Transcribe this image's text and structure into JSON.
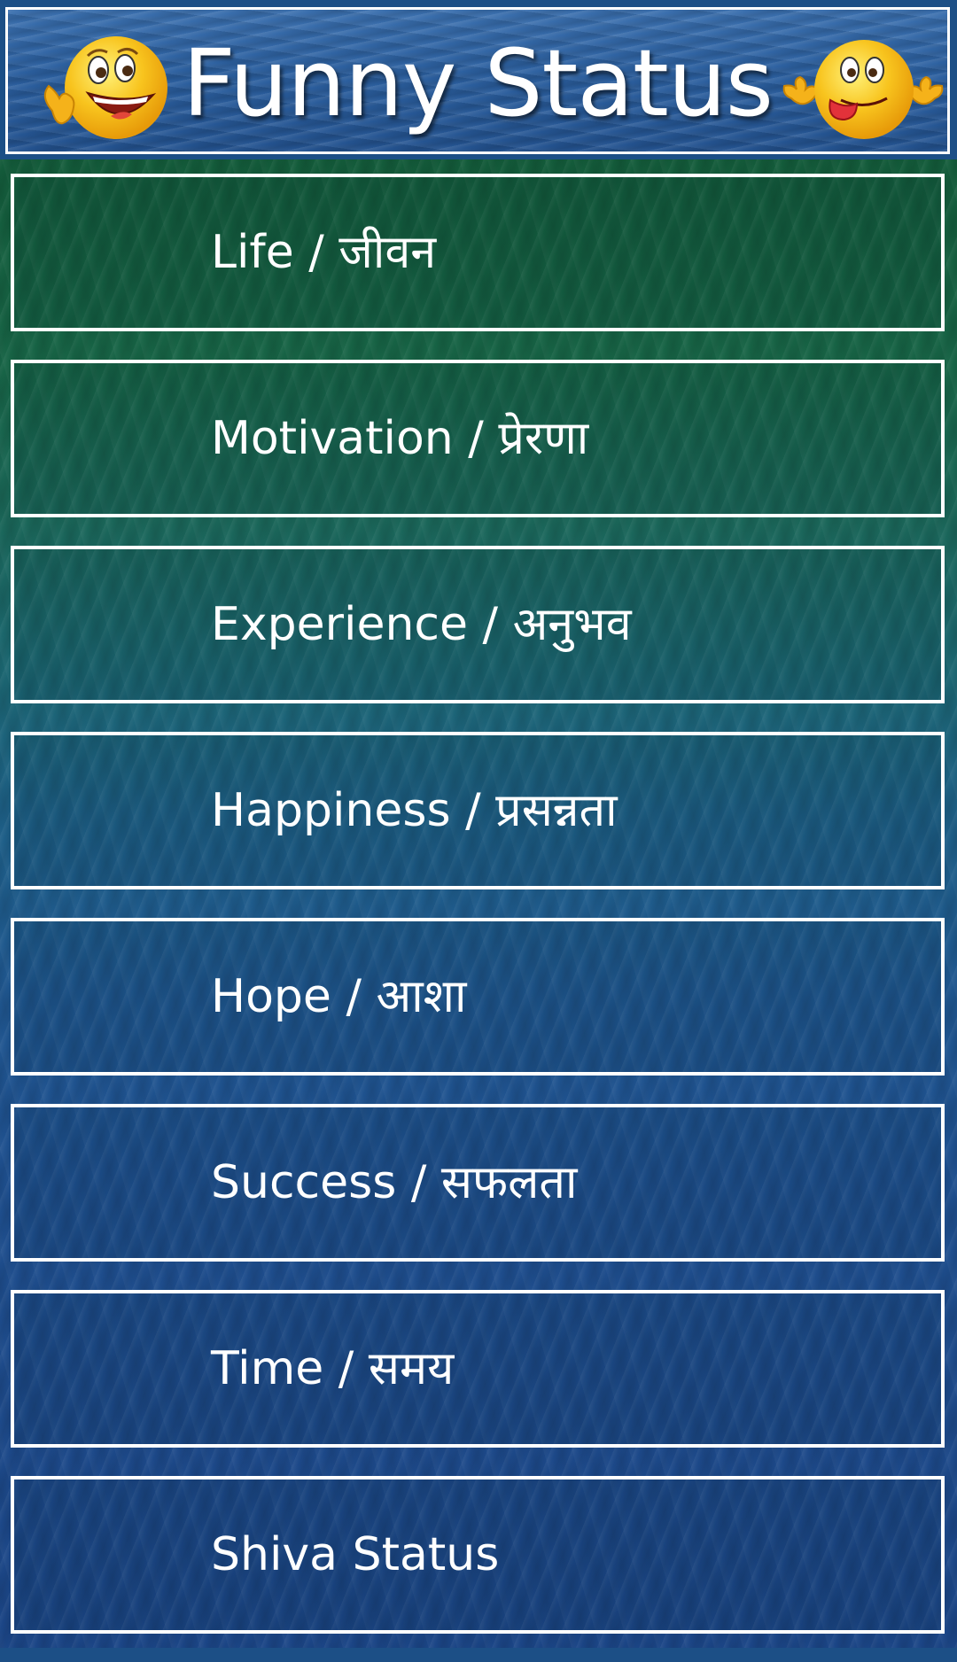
{
  "header": {
    "title": "Funny Status",
    "left_icon": "laughing-smiley-icon",
    "right_icon": "tongue-out-smiley-icon"
  },
  "categories": [
    {
      "label": "Life / जीवन"
    },
    {
      "label": "Motivation / प्रेरणा"
    },
    {
      "label": "Experience / अनुभव"
    },
    {
      "label": "Happiness / प्रसन्नता"
    },
    {
      "label": "Hope / आशा"
    },
    {
      "label": "Success / सफलता"
    },
    {
      "label": "Time / समय"
    },
    {
      "label": "Shiva Status"
    }
  ],
  "colors": {
    "text": "#ffffff",
    "border": "#ffffff",
    "emoji_yellow": "#f7c21c"
  }
}
